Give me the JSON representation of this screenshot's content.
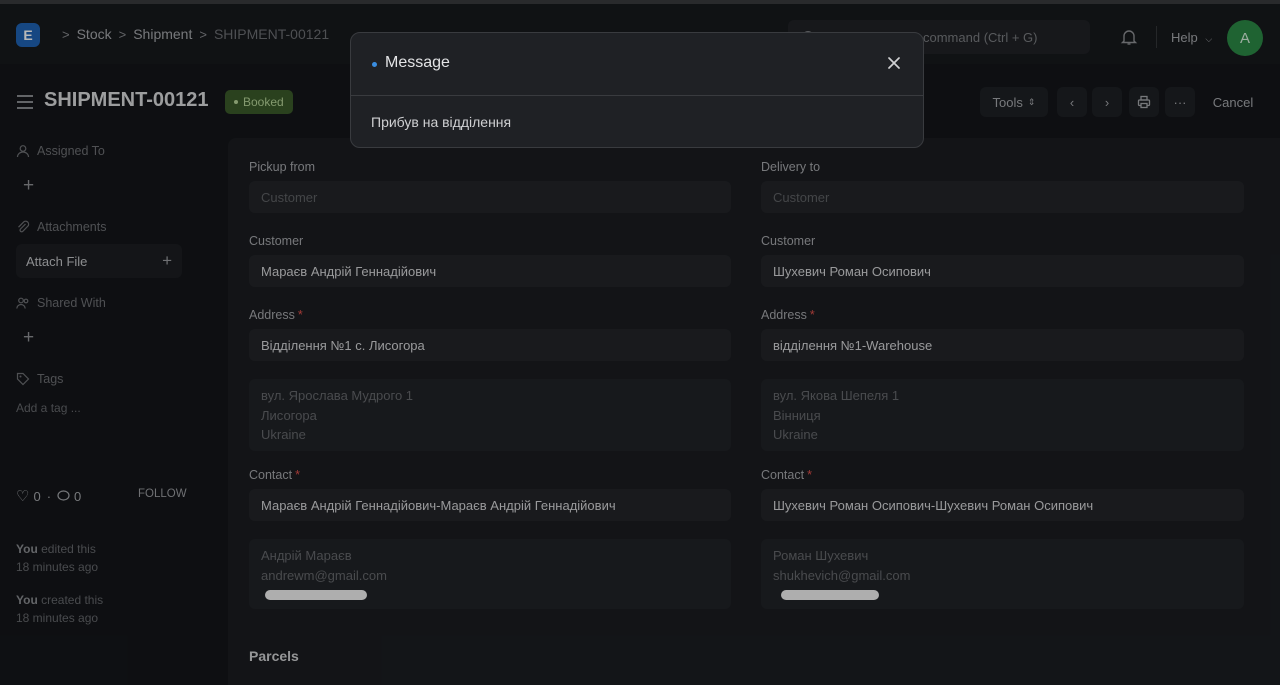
{
  "navbar": {
    "logo_letter": "E",
    "breadcrumbs": [
      "Stock",
      "Shipment",
      "SHIPMENT-00121"
    ],
    "search_placeholder": "Search or type a command (Ctrl + G)",
    "help_label": "Help",
    "avatar_letter": "A"
  },
  "page": {
    "title": "SHIPMENT-00121",
    "status": "Booked",
    "tools_label": "Tools",
    "cancel_label": "Cancel"
  },
  "sidebar": {
    "assigned_to": "Assigned To",
    "attachments": "Attachments",
    "attach_file": "Attach File",
    "shared_with": "Shared With",
    "tags": "Tags",
    "add_tag": "Add a tag ...",
    "likes": "0",
    "comments": "0",
    "follow": "FOLLOW",
    "activity": [
      {
        "who": "You",
        "what": " edited this",
        "when": "18 minutes ago"
      },
      {
        "who": "You",
        "what": " created this",
        "when": "18 minutes ago"
      }
    ]
  },
  "form": {
    "pickup": {
      "label": "Pickup from",
      "type_placeholder": "Customer",
      "customer_label": "Customer",
      "customer": "Мараєв Андрій Геннадійович",
      "address_label": "Address",
      "address": "Відділення №1 с. Лисогора",
      "address_lines": [
        "вул. Ярослава Мудрого 1",
        "Лисогора",
        "Ukraine"
      ],
      "contact_label": "Contact",
      "contact": "Мараєв Андрій Геннадійович-Мараєв Андрій Геннадійович",
      "contact_lines": [
        "Андрій Мараєв",
        "andrewm@gmail.com"
      ]
    },
    "delivery": {
      "label": "Delivery to",
      "type_placeholder": "Customer",
      "customer_label": "Customer",
      "customer": "Шухевич Роман Осипович",
      "address_label": "Address",
      "address": "відділення №1-Warehouse",
      "address_lines": [
        "вул. Якова Шепеля 1",
        "Вінниця",
        "Ukraine"
      ],
      "contact_label": "Contact",
      "contact": "Шухевич Роман Осипович-Шухевич Роман Осипович",
      "contact_lines": [
        "Роман Шухевич",
        "shukhevich@gmail.com"
      ]
    },
    "parcels_heading": "Parcels"
  },
  "modal": {
    "title": "Message",
    "body": "Прибув на відділення"
  },
  "colors": {
    "accent": "#1f63b4",
    "status_booked": "#3b5a2a",
    "avatar": "#2c8a46",
    "required": "#e2504b"
  }
}
